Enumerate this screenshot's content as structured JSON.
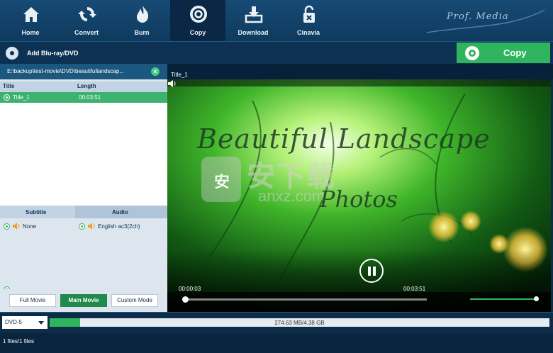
{
  "nav": {
    "items": [
      {
        "label": "Home",
        "icon": "home-icon"
      },
      {
        "label": "Convert",
        "icon": "convert-icon"
      },
      {
        "label": "Burn",
        "icon": "burn-icon"
      },
      {
        "label": "Copy",
        "icon": "copy-icon",
        "active": true
      },
      {
        "label": "Download",
        "icon": "download-icon"
      },
      {
        "label": "Cinavia",
        "icon": "cinavia-icon"
      }
    ],
    "brand": "Prof. Media"
  },
  "toolbar": {
    "add_label": "Add Blu-ray/DVD",
    "copy_label": "Copy"
  },
  "source": {
    "path": "E:\\backup\\test-movie\\DVD\\beautifullandscap...",
    "columns": [
      "Title",
      "Length"
    ],
    "titles": [
      {
        "title": "Title_1",
        "length": "00:03:51",
        "selected": true
      }
    ]
  },
  "tracks": {
    "subtitle_header": "Subtitle",
    "audio_header": "Audio",
    "subtitle": "None",
    "audio": "English ac3(2ch)"
  },
  "modes": {
    "full": "Full Movie",
    "main": "Main Movie",
    "custom": "Custom Mode",
    "selected": "Main Movie"
  },
  "player": {
    "title": "Title_1",
    "video_title": "Beautiful Landscape",
    "video_subtitle": "Photos",
    "current_time": "00:00:03",
    "total_time": "00:03:51",
    "watermark": "安下载",
    "watermark_sub": "anxz.com"
  },
  "output": {
    "disc_type": "DVD-5",
    "capacity_text": "274.63 MB/4.38 GB",
    "capacity_fraction": 0.0612
  },
  "status": {
    "text": "1 files/1 files"
  },
  "colors": {
    "accent_green": "#2fb55d",
    "nav_bg": "#174a74"
  }
}
